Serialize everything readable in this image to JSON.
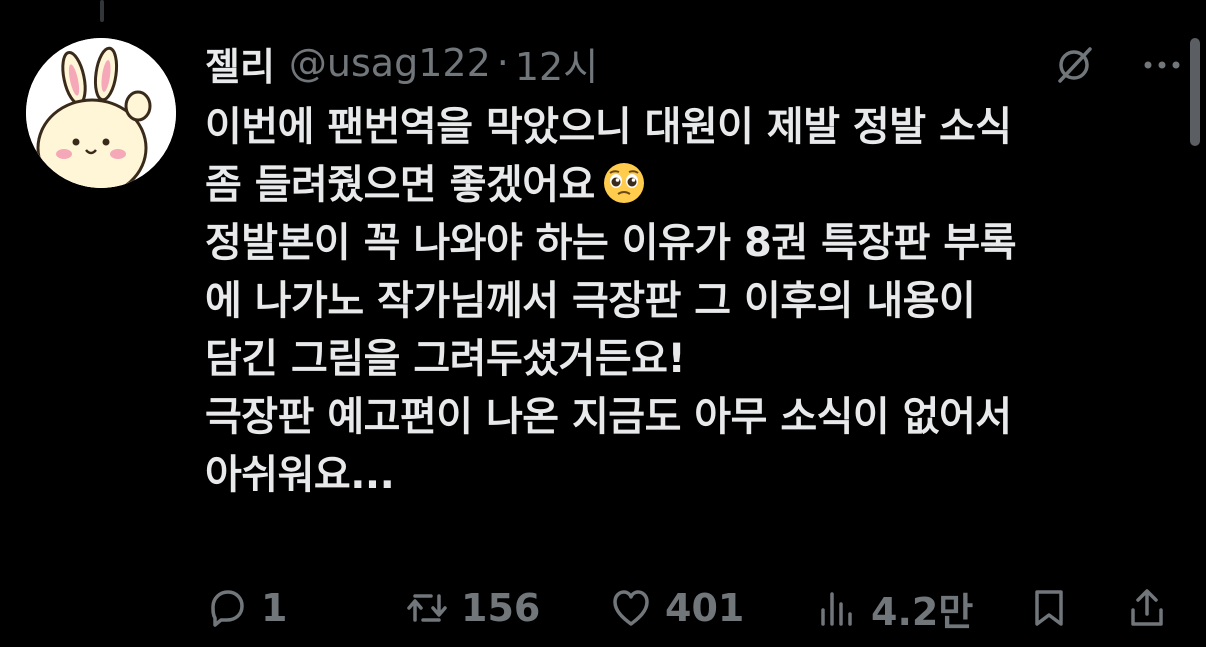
{
  "author": {
    "display_name": "젤리",
    "handle": "@usag122",
    "separator": "·",
    "time": "12시"
  },
  "tweet": {
    "text": "이번에 팬번역을 막았으니 대원이 제발 정발 소식\n좀 들려줬으면 좋겠어요",
    "text2": "정발본이 꼭 나와야 하는 이유가 8권 특장판 부록\n에 나가노 작가님께서 극장판 그 이후의 내용이\n담긴 그림을 그려두셨거든요!\n극장판 예고편이 나온 지금도 아무 소식이 없어서\n아쉬워요...",
    "emoji": "pleading-face"
  },
  "actions": {
    "reply_count": "1",
    "retweet_count": "156",
    "like_count": "401",
    "views_count": "4.2만"
  },
  "icons": [
    "avatar-bunny",
    "grok-icon",
    "more-icon",
    "reply-icon",
    "retweet-icon",
    "like-icon",
    "views-icon",
    "bookmark-icon",
    "share-icon"
  ],
  "colors": {
    "background": "#000000",
    "text": "#e7e9ea",
    "secondary": "#71767b"
  }
}
